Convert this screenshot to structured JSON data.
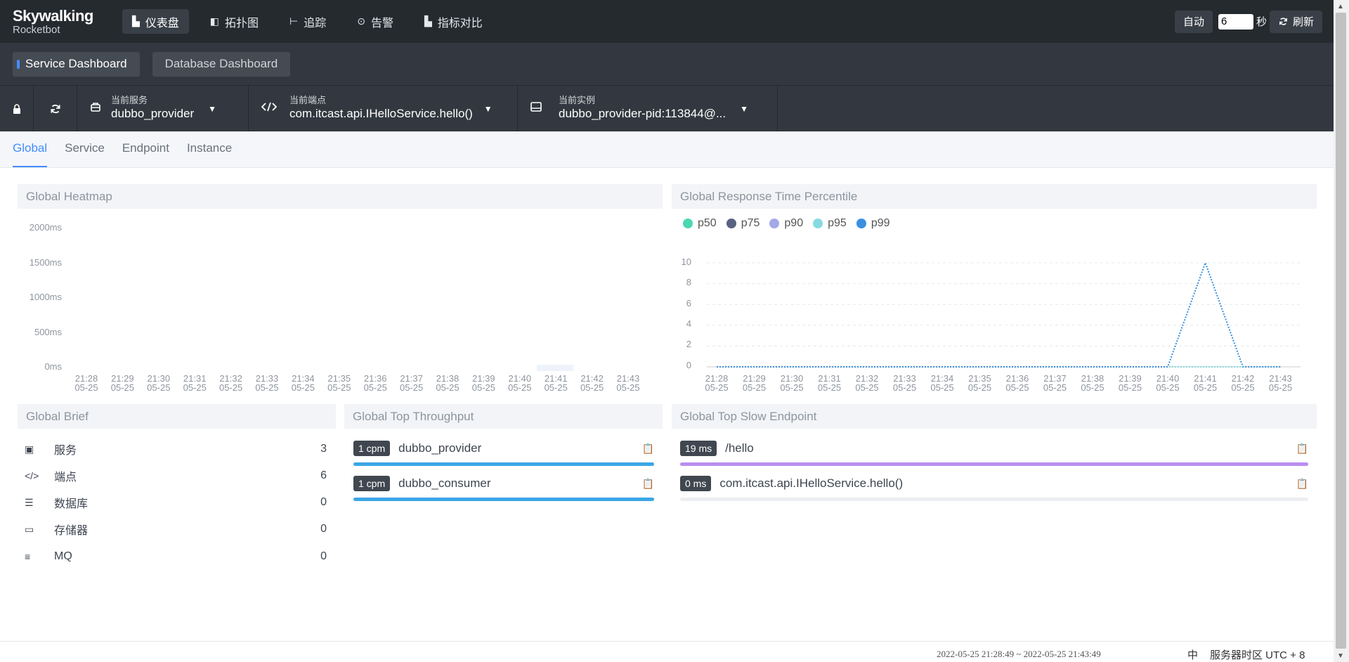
{
  "brand": {
    "title": "Skywalking",
    "subtitle": "Rocketbot"
  },
  "nav": [
    {
      "icon": "dashboard-icon",
      "glyph": "▙",
      "label": "仪表盘",
      "active": true
    },
    {
      "icon": "topology-icon",
      "glyph": "◧",
      "label": "拓扑图",
      "active": false
    },
    {
      "icon": "trace-icon",
      "glyph": "⊢",
      "label": "追踪",
      "active": false
    },
    {
      "icon": "alarm-icon",
      "glyph": "⊙",
      "label": "告警",
      "active": false
    },
    {
      "icon": "metric-compare-icon",
      "glyph": "▙",
      "label": "指标对比",
      "active": false
    }
  ],
  "toolbar": {
    "auto_label": "自动",
    "interval_value": "6",
    "interval_unit": "秒",
    "refresh_label": "刷新"
  },
  "dashboards": [
    {
      "label": "Service Dashboard",
      "active": true
    },
    {
      "label": "Database Dashboard",
      "active": false
    }
  ],
  "selectors": {
    "service": {
      "label": "当前服务",
      "value": "dubbo_provider"
    },
    "endpoint": {
      "label": "当前端点",
      "value": "com.itcast.api.IHelloService.hello()"
    },
    "instance": {
      "label": "当前实例",
      "value": "dubbo_provider-pid:113844@..."
    }
  },
  "tabs": [
    {
      "label": "Global",
      "active": true
    },
    {
      "label": "Service",
      "active": false
    },
    {
      "label": "Endpoint",
      "active": false
    },
    {
      "label": "Instance",
      "active": false
    }
  ],
  "heatmap": {
    "title": "Global Heatmap",
    "y_ticks": [
      "2000ms",
      "1500ms",
      "1000ms",
      "500ms",
      "0ms"
    ]
  },
  "times": [
    "21:28",
    "21:29",
    "21:30",
    "21:31",
    "21:32",
    "21:33",
    "21:34",
    "21:35",
    "21:36",
    "21:37",
    "21:38",
    "21:39",
    "21:40",
    "21:41",
    "21:42",
    "21:43"
  ],
  "date": "05-25",
  "chart_data": {
    "type": "line",
    "title": "Global Response Time Percentile",
    "x": [
      "21:28",
      "21:29",
      "21:30",
      "21:31",
      "21:32",
      "21:33",
      "21:34",
      "21:35",
      "21:36",
      "21:37",
      "21:38",
      "21:39",
      "21:40",
      "21:41",
      "21:42",
      "21:43"
    ],
    "y_ticks": [
      "10",
      "8",
      "6",
      "4",
      "2",
      "0"
    ],
    "ylim": [
      0,
      10
    ],
    "grid": true,
    "legend_position": "top-left",
    "series": [
      {
        "name": "p50",
        "color": "#4cd7b0",
        "values": [
          0,
          0,
          0,
          0,
          0,
          0,
          0,
          0,
          0,
          0,
          0,
          0,
          0,
          0,
          0,
          0
        ]
      },
      {
        "name": "p75",
        "color": "#5a6282",
        "values": [
          0,
          0,
          0,
          0,
          0,
          0,
          0,
          0,
          0,
          0,
          0,
          0,
          0,
          0,
          0,
          0
        ]
      },
      {
        "name": "p90",
        "color": "#a4a7e8",
        "values": [
          0,
          0,
          0,
          0,
          0,
          0,
          0,
          0,
          0,
          0,
          0,
          0,
          0,
          0,
          0,
          0
        ]
      },
      {
        "name": "p95",
        "color": "#85dbe0",
        "values": [
          0,
          0,
          0,
          0,
          0,
          0,
          0,
          0,
          0,
          0,
          0,
          0,
          0,
          0,
          0,
          0
        ]
      },
      {
        "name": "p99",
        "color": "#3a8fe0",
        "values": [
          0,
          0,
          0,
          0,
          0,
          0,
          0,
          0,
          0,
          0,
          0,
          0,
          0,
          10,
          0,
          0
        ]
      }
    ]
  },
  "brief": {
    "title": "Global Brief",
    "items": [
      {
        "icon": "service-icon",
        "glyph": "▣",
        "label": "服务",
        "value": "3"
      },
      {
        "icon": "endpoint-icon",
        "glyph": "</>",
        "label": "端点",
        "value": "6"
      },
      {
        "icon": "database-icon",
        "glyph": "☰",
        "label": "数据库",
        "value": "0"
      },
      {
        "icon": "storage-icon",
        "glyph": "▭",
        "label": "存储器",
        "value": "0"
      },
      {
        "icon": "mq-icon",
        "glyph": "≡",
        "label": "MQ",
        "value": "0"
      }
    ]
  },
  "throughput": {
    "title": "Global Top Throughput",
    "items": [
      {
        "badge": "1 cpm",
        "name": "dubbo_provider",
        "fill": 1
      },
      {
        "badge": "1 cpm",
        "name": "dubbo_consumer",
        "fill": 1
      }
    ]
  },
  "slow": {
    "title": "Global Top Slow Endpoint",
    "items": [
      {
        "badge": "19 ms",
        "name": "/hello",
        "fill": 1
      },
      {
        "badge": "0 ms",
        "name": "com.itcast.api.IHelloService.hello()",
        "fill": 0
      }
    ]
  },
  "colors": {
    "throughput_bar": "#3ba6e5",
    "slow_bar": "#b98ef0",
    "accent": "#448dfe"
  },
  "footer": {
    "time_range": "2022-05-25 21:28:49 ~ 2022-05-25 21:43:49",
    "lang": "中",
    "timezone": "服务器时区 UTC + 8"
  }
}
